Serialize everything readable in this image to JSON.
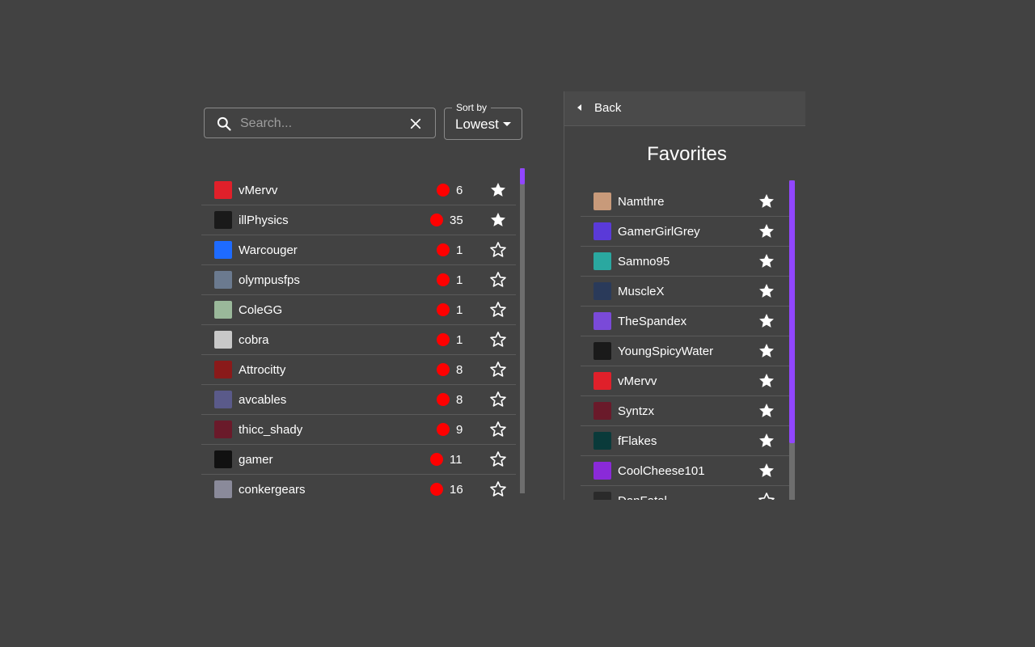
{
  "search": {
    "placeholder": "Search...",
    "value": ""
  },
  "sort": {
    "label": "Sort by",
    "value": "Lowest"
  },
  "streams": [
    {
      "name": "vMervv",
      "viewers": "6",
      "favorite": true,
      "avatar_color": "#e0202a"
    },
    {
      "name": "illPhysics",
      "viewers": "35",
      "favorite": true,
      "avatar_color": "#1a1a1a"
    },
    {
      "name": "Warcouger",
      "viewers": "1",
      "favorite": false,
      "avatar_color": "#1e6bff"
    },
    {
      "name": "olympusfps",
      "viewers": "1",
      "favorite": false,
      "avatar_color": "#6b7a8f"
    },
    {
      "name": "ColeGG",
      "viewers": "1",
      "favorite": false,
      "avatar_color": "#9ab89a"
    },
    {
      "name": "cobra",
      "viewers": "1",
      "favorite": false,
      "avatar_color": "#c8c8c8"
    },
    {
      "name": "Attrocitty",
      "viewers": "8",
      "favorite": false,
      "avatar_color": "#8a1a1a"
    },
    {
      "name": "avcables",
      "viewers": "8",
      "favorite": false,
      "avatar_color": "#5a5a8a"
    },
    {
      "name": "thicc_shady",
      "viewers": "9",
      "favorite": false,
      "avatar_color": "#6a1a2a"
    },
    {
      "name": "gamer",
      "viewers": "11",
      "favorite": false,
      "avatar_color": "#111111"
    },
    {
      "name": "conkergears",
      "viewers": "16",
      "favorite": false,
      "avatar_color": "#8a8a9a"
    }
  ],
  "favorites_panel": {
    "back_label": "Back",
    "title": "Favorites",
    "items": [
      {
        "name": "Namthre",
        "favorite": true,
        "avatar_color": "#c89a7a"
      },
      {
        "name": "GamerGirlGrey",
        "favorite": true,
        "avatar_color": "#5a3ad8"
      },
      {
        "name": "Samno95",
        "favorite": true,
        "avatar_color": "#2aa8a0"
      },
      {
        "name": "MuscleX",
        "favorite": true,
        "avatar_color": "#2a3a5a"
      },
      {
        "name": "TheSpandex",
        "favorite": true,
        "avatar_color": "#7a4ad8"
      },
      {
        "name": "YoungSpicyWater",
        "favorite": true,
        "avatar_color": "#1a1a1a"
      },
      {
        "name": "vMervv",
        "favorite": true,
        "avatar_color": "#e0202a"
      },
      {
        "name": "Syntzx",
        "favorite": true,
        "avatar_color": "#6a1a2a"
      },
      {
        "name": "fFlakes",
        "favorite": true,
        "avatar_color": "#0a3a3a"
      },
      {
        "name": "CoolCheese101",
        "favorite": true,
        "avatar_color": "#8a2ad8"
      },
      {
        "name": "DanFatal",
        "favorite": false,
        "avatar_color": "#2a2a2a"
      }
    ]
  },
  "colors": {
    "background": "#424242",
    "live": "#ff0000",
    "accent": "#9146ff",
    "divider": "#5a5a5a"
  },
  "icons": {
    "search": "search-icon",
    "clear": "close-icon",
    "sort_caret": "caret-down-icon",
    "back": "caret-left-icon",
    "favorite_on": "star-filled-icon",
    "favorite_off": "star-outline-icon",
    "live": "live-dot-icon"
  }
}
